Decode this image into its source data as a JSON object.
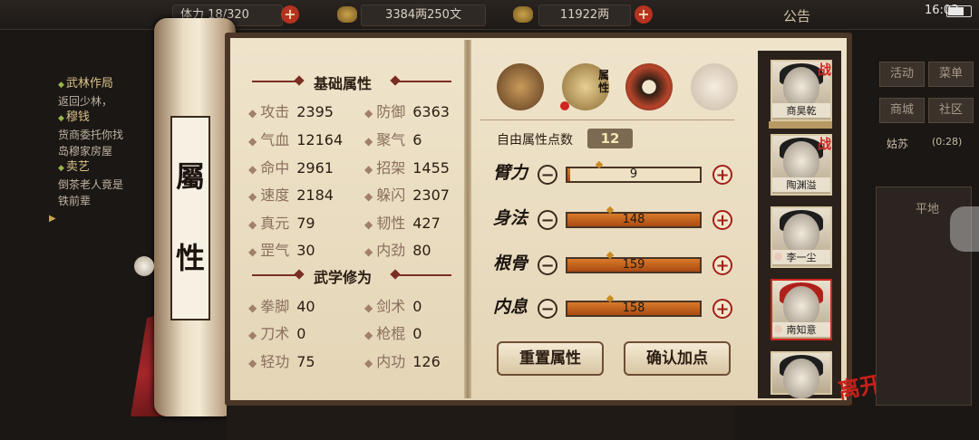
{
  "status_bar": {
    "stamina_label": "体力",
    "stamina_value": "18/320",
    "money": "3384两250文",
    "gold": "11922两",
    "notice": "公告",
    "time": "16:03"
  },
  "quest_panel": {
    "quests": [
      {
        "title": "武林作局",
        "lines": [
          "返回少林，"
        ]
      },
      {
        "title": "穆钱",
        "lines": [
          "货商委托你找",
          "岛穆家房屋"
        ]
      },
      {
        "title": "卖艺",
        "lines": [
          "倒茶老人竟是",
          "铁前辈"
        ]
      }
    ]
  },
  "scroll": {
    "label_line1": "屬",
    "label_line2": "性"
  },
  "basic_attrs": {
    "title": "基础属性",
    "stats": [
      {
        "label": "攻击",
        "value": "2395"
      },
      {
        "label": "防御",
        "value": "6363"
      },
      {
        "label": "气血",
        "value": "12164"
      },
      {
        "label": "聚气",
        "value": "6"
      },
      {
        "label": "命中",
        "value": "2961"
      },
      {
        "label": "招架",
        "value": "1455"
      },
      {
        "label": "速度",
        "value": "2184"
      },
      {
        "label": "躲闪",
        "value": "2307"
      },
      {
        "label": "真元",
        "value": "79"
      },
      {
        "label": "韧性",
        "value": "427"
      },
      {
        "label": "罡气",
        "value": "30"
      },
      {
        "label": "内劲",
        "value": "80"
      }
    ]
  },
  "martial": {
    "title": "武学修为",
    "stats": [
      {
        "label": "拳脚",
        "value": "40"
      },
      {
        "label": "剑术",
        "value": "0"
      },
      {
        "label": "刀术",
        "value": "0"
      },
      {
        "label": "枪棍",
        "value": "0"
      },
      {
        "label": "轻功",
        "value": "75"
      },
      {
        "label": "内功",
        "value": "126"
      }
    ]
  },
  "tabs": [
    {
      "icon": "straw-hat-icon",
      "label": ""
    },
    {
      "icon": "scroll-book-icon",
      "label": "属性"
    },
    {
      "icon": "bagua-icon",
      "label": ""
    },
    {
      "icon": "meridian-body-icon",
      "label": ""
    }
  ],
  "free_points": {
    "label": "自由属性点数",
    "value": "12"
  },
  "attributes": [
    {
      "name": "臂力",
      "value": 9,
      "fill": 0.02,
      "mark": 0.24
    },
    {
      "name": "身法",
      "value": 148,
      "fill": 1.0,
      "mark": 0.32
    },
    {
      "name": "根骨",
      "value": 159,
      "fill": 1.0,
      "mark": 0.32
    },
    {
      "name": "内息",
      "value": 158,
      "fill": 1.0,
      "mark": 0.32
    }
  ],
  "buttons": {
    "reset": "重置属性",
    "confirm": "确认加点"
  },
  "party": [
    {
      "name": "商昊乾",
      "battle": "战"
    },
    {
      "name": "陶渊溢",
      "battle": "战"
    },
    {
      "name": "李一尘",
      "battle": ""
    },
    {
      "name": "南知意",
      "battle": ""
    },
    {
      "name": "",
      "battle": ""
    }
  ],
  "leave_label": "离开",
  "right_menu": {
    "items": [
      "活动",
      "菜单",
      "商城",
      "社区"
    ],
    "location": "姑苏",
    "location_time": "(0:28)",
    "map_label": "平地"
  },
  "colors": {
    "accent": "#a3201a",
    "bar": "#d97a2a",
    "paper": "#efe4cb"
  }
}
